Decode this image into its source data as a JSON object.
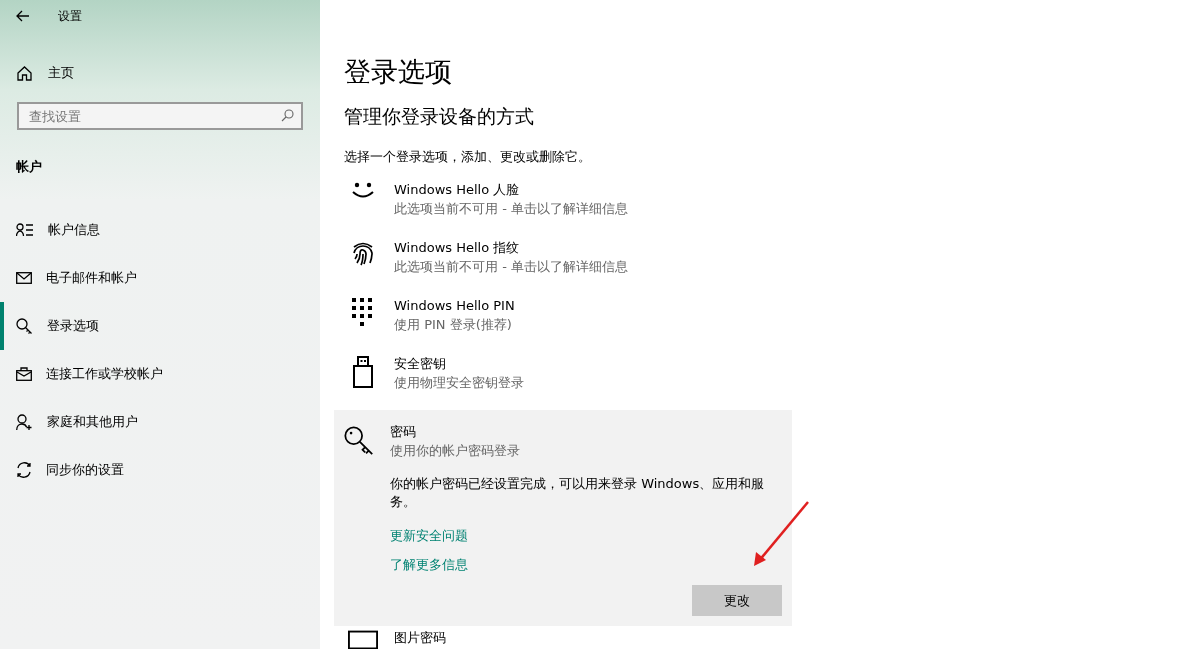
{
  "sidebar": {
    "title": "设置",
    "home": "主页",
    "search": {
      "placeholder": "查找设置"
    },
    "section": "帐户",
    "items": [
      {
        "label": "帐户信息",
        "kind": "info",
        "selected": false
      },
      {
        "label": "电子邮件和帐户",
        "kind": "email",
        "selected": false
      },
      {
        "label": "登录选项",
        "kind": "signin",
        "selected": true
      },
      {
        "label": "连接工作或学校帐户",
        "kind": "work",
        "selected": false
      },
      {
        "label": "家庭和其他用户",
        "kind": "family",
        "selected": false
      },
      {
        "label": "同步你的设置",
        "kind": "sync",
        "selected": false
      }
    ]
  },
  "main": {
    "title": "登录选项",
    "subtitle": "管理你登录设备的方式",
    "description": "选择一个登录选项，添加、更改或删除它。",
    "options": [
      {
        "kind": "face",
        "name": "Windows Hello 人脸",
        "detail": "此选项当前不可用 - 单击以了解详细信息",
        "expanded": false
      },
      {
        "kind": "fingerprint",
        "name": "Windows Hello 指纹",
        "detail": "此选项当前不可用 - 单击以了解详细信息",
        "expanded": false
      },
      {
        "kind": "pin",
        "name": "Windows Hello PIN",
        "detail": "使用 PIN 登录(推荐)",
        "expanded": false
      },
      {
        "kind": "securitykey",
        "name": "安全密钥",
        "detail": "使用物理安全密钥登录",
        "expanded": false
      },
      {
        "kind": "password",
        "name": "密码",
        "detail": "使用你的帐户密码登录",
        "expanded": true,
        "body": "你的帐户密码已经设置完成，可以用来登录 Windows、应用和服务。",
        "links": [
          "更新安全问题",
          "了解更多信息"
        ],
        "button": "更改"
      },
      {
        "kind": "picture",
        "name": "图片密码",
        "expanded": false
      }
    ]
  }
}
